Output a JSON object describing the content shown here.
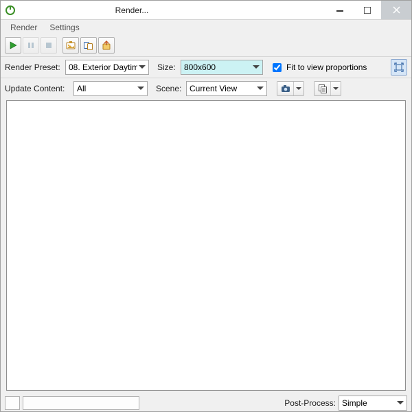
{
  "window": {
    "title": "Render..."
  },
  "menubar": {
    "items": [
      "Render",
      "Settings"
    ]
  },
  "toolbar": {
    "play": "play-icon",
    "pause": "pause-icon",
    "stop": "stop-icon",
    "save": "save-image-icon",
    "save_masks": "save-masks-icon",
    "export": "export-icon"
  },
  "row1": {
    "preset_label": "Render Preset:",
    "preset_value": "08. Exterior Daytim",
    "size_label": "Size:",
    "size_value": "800x600",
    "fit_label": "Fit to view proportions",
    "fit_checked": true
  },
  "row2": {
    "update_label": "Update Content:",
    "update_value": "All",
    "scene_label": "Scene:",
    "scene_value": "Current View"
  },
  "status": {
    "post_label": "Post-Process:",
    "post_value": "Simple"
  }
}
